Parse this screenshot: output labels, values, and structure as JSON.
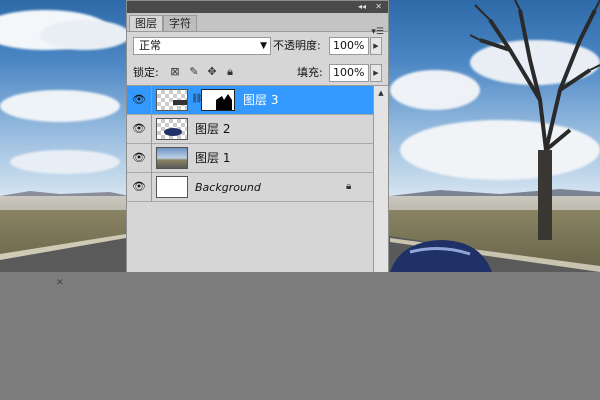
{
  "panel": {
    "tabs": [
      "图层",
      "字符"
    ],
    "blend_mode": "正常",
    "opacity_label": "不透明度:",
    "opacity_value": "100%",
    "lock_label": "锁定:",
    "fill_label": "填充:",
    "fill_value": "100%",
    "layers": [
      {
        "name": "图层 3",
        "selected": true
      },
      {
        "name": "图层 2",
        "selected": false
      },
      {
        "name": "图层 1",
        "selected": false
      },
      {
        "name": "Background",
        "selected": false
      }
    ]
  },
  "icons": {
    "collapse": "double-arrow-icon",
    "close": "close-icon",
    "panel_menu": "panel-menu-icon",
    "lock_transparent": "lock-transparent-pixels-icon",
    "lock_image": "lock-image-pixels-icon",
    "lock_position": "lock-position-icon",
    "lock_all": "lock-all-icon",
    "visibility": "eye-icon",
    "link": "chain-link-icon",
    "background_lock": "padlock-icon"
  },
  "colors": {
    "selected_row": "#3399ff",
    "panel_bg": "#d6d6d6",
    "canvas_gray": "#7c7c7c"
  }
}
